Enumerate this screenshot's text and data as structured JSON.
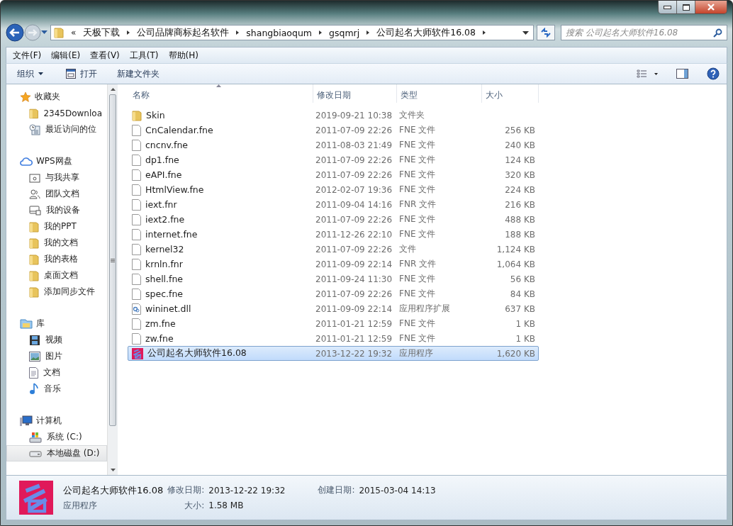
{
  "address_bar": {
    "overflow": "«",
    "crumbs": [
      "天极下载",
      "公司品牌商标起名软件",
      "shangbiaoqum",
      "gsqmrj",
      "公司起名大师软件16.08"
    ]
  },
  "search": {
    "placeholder": "搜索 公司起名大师软件16.08"
  },
  "menu_bar": [
    "文件(F)",
    "编辑(E)",
    "查看(V)",
    "工具(T)",
    "帮助(H)"
  ],
  "toolbar": {
    "organize": "组织",
    "open": "打开",
    "new_folder": "新建文件夹"
  },
  "sidebar": {
    "groups": [
      {
        "label": "收藏夹",
        "kind": "star",
        "children": [
          {
            "label": "2345Downloa",
            "kind": "folder",
            "selected": false
          },
          {
            "label": "最近访问的位",
            "kind": "recent",
            "selected": false
          }
        ]
      },
      {
        "label": "WPS网盘",
        "kind": "cloud",
        "children": [
          {
            "label": "与我共享",
            "kind": "share",
            "selected": false
          },
          {
            "label": "团队文档",
            "kind": "team",
            "selected": false
          },
          {
            "label": "我的设备",
            "kind": "device",
            "selected": false
          },
          {
            "label": "我的PPT",
            "kind": "folder",
            "selected": false
          },
          {
            "label": "我的文档",
            "kind": "folder",
            "selected": false
          },
          {
            "label": "我的表格",
            "kind": "folder",
            "selected": false
          },
          {
            "label": "桌面文档",
            "kind": "folder",
            "selected": false
          },
          {
            "label": "添加同步文件",
            "kind": "folder",
            "selected": false
          }
        ]
      },
      {
        "label": "库",
        "kind": "library",
        "children": [
          {
            "label": "视频",
            "kind": "video",
            "selected": false
          },
          {
            "label": "图片",
            "kind": "picture",
            "selected": false
          },
          {
            "label": "文档",
            "kind": "document",
            "selected": false
          },
          {
            "label": "音乐",
            "kind": "music",
            "selected": false
          }
        ]
      },
      {
        "label": "计算机",
        "kind": "computer",
        "children": [
          {
            "label": "系统 (C:)",
            "kind": "system-drive",
            "selected": false
          },
          {
            "label": "本地磁盘 (D:)",
            "kind": "drive",
            "selected": true
          }
        ]
      }
    ]
  },
  "table": {
    "columns": [
      "名称",
      "修改日期",
      "类型",
      "大小"
    ],
    "rows": [
      {
        "name": "Skin",
        "date": "2019-09-21 10:38",
        "type": "文件夹",
        "kind": "folder",
        "selected": false
      },
      {
        "name": "CnCalendar.fne",
        "date": "2011-07-09 22:26",
        "type": "FNE 文件",
        "size": "256 KB",
        "kind": "file",
        "selected": false
      },
      {
        "name": "cncnv.fne",
        "date": "2011-08-03 21:49",
        "type": "FNE 文件",
        "size": "240 KB",
        "kind": "file",
        "selected": false
      },
      {
        "name": "dp1.fne",
        "date": "2011-07-09 22:26",
        "type": "FNE 文件",
        "size": "124 KB",
        "kind": "file",
        "selected": false
      },
      {
        "name": "eAPI.fne",
        "date": "2011-07-09 22:26",
        "type": "FNE 文件",
        "size": "320 KB",
        "kind": "file",
        "selected": false
      },
      {
        "name": "HtmlView.fne",
        "date": "2012-02-07 19:36",
        "type": "FNE 文件",
        "size": "224 KB",
        "kind": "file",
        "selected": false
      },
      {
        "name": "iext.fnr",
        "date": "2011-09-04 14:16",
        "type": "FNR 文件",
        "size": "216 KB",
        "kind": "file",
        "selected": false
      },
      {
        "name": "iext2.fne",
        "date": "2011-07-09 22:26",
        "type": "FNE 文件",
        "size": "488 KB",
        "kind": "file",
        "selected": false
      },
      {
        "name": "internet.fne",
        "date": "2011-12-26 22:10",
        "type": "FNE 文件",
        "size": "188 KB",
        "kind": "file",
        "selected": false
      },
      {
        "name": "kernel32",
        "date": "2011-07-09 22:26",
        "type": "文件",
        "size": "1,124 KB",
        "kind": "file",
        "selected": false
      },
      {
        "name": "krnln.fnr",
        "date": "2011-09-09 22:14",
        "type": "FNR 文件",
        "size": "1,064 KB",
        "kind": "file",
        "selected": false
      },
      {
        "name": "shell.fne",
        "date": "2011-09-24 11:30",
        "type": "FNE 文件",
        "size": "56 KB",
        "kind": "file",
        "selected": false
      },
      {
        "name": "spec.fne",
        "date": "2011-07-09 22:26",
        "type": "FNE 文件",
        "size": "84 KB",
        "kind": "file",
        "selected": false
      },
      {
        "name": "wininet.dll",
        "date": "2011-09-09 22:14",
        "type": "应用程序扩展",
        "size": "637 KB",
        "kind": "dll",
        "selected": false
      },
      {
        "name": "zm.fne",
        "date": "2011-01-21 12:59",
        "type": "FNE 文件",
        "size": "1 KB",
        "kind": "file",
        "selected": false
      },
      {
        "name": "zw.fne",
        "date": "2011-01-21 12:59",
        "type": "FNE 文件",
        "size": "1 KB",
        "kind": "file",
        "selected": false
      },
      {
        "name": "公司起名大师软件16.08",
        "date": "2013-12-22 19:32",
        "type": "应用程序",
        "size": "1,620 KB",
        "kind": "app",
        "selected": true
      }
    ]
  },
  "details_pane": {
    "name": "公司起名大师软件16.08",
    "type": "应用程序",
    "modified_label": "修改日期:",
    "modified": "2013-12-22 19:32",
    "size_label": "大小:",
    "size": "1.58 MB",
    "created_label": "创建日期:",
    "created": "2015-03-04 14:13"
  }
}
